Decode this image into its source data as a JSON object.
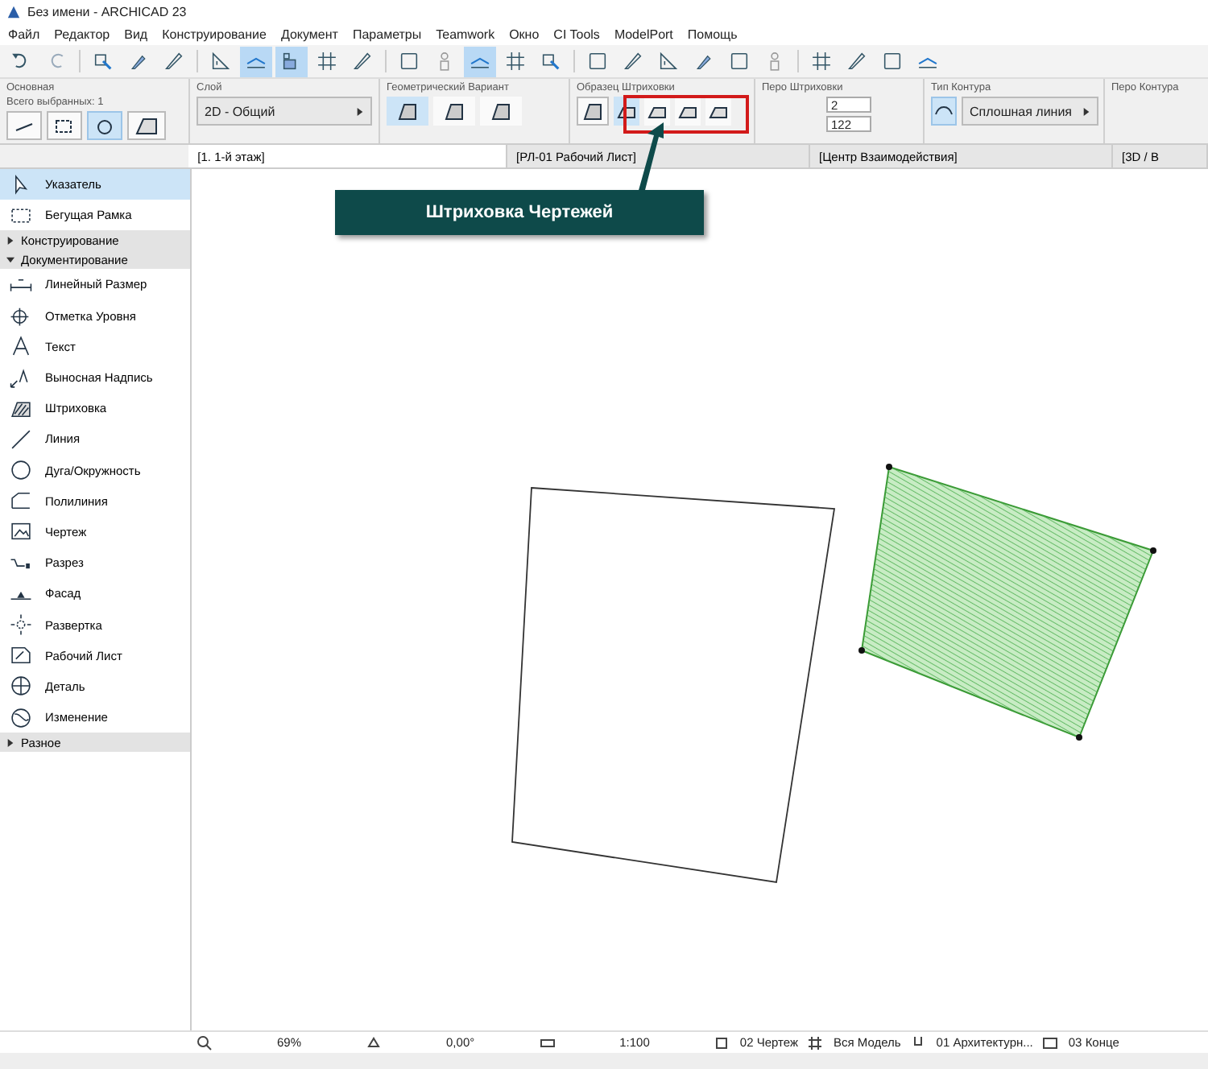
{
  "window": {
    "title": "Без имени - ARCHICAD 23"
  },
  "menu": [
    "Файл",
    "Редактор",
    "Вид",
    "Конструирование",
    "Документ",
    "Параметры",
    "Teamwork",
    "Окно",
    "CI Tools",
    "ModelPort",
    "Помощь"
  ],
  "toolbar": [
    {
      "kind": "undo",
      "selected": false
    },
    {
      "kind": "redo",
      "selected": false
    },
    {
      "kind": "sep"
    },
    {
      "kind": "pick",
      "selected": false
    },
    {
      "kind": "dropper",
      "selected": false
    },
    {
      "kind": "pen",
      "selected": false
    },
    {
      "kind": "sep"
    },
    {
      "kind": "angle",
      "selected": false
    },
    {
      "kind": "snap",
      "selected": true
    },
    {
      "kind": "layer",
      "selected": true
    },
    {
      "kind": "grid",
      "selected": false
    },
    {
      "kind": "pen",
      "selected": false
    },
    {
      "kind": "sep"
    },
    {
      "kind": "frame",
      "selected": false
    },
    {
      "kind": "person",
      "selected": false
    },
    {
      "kind": "snap",
      "selected": true
    },
    {
      "kind": "grid",
      "selected": false
    },
    {
      "kind": "pick",
      "selected": false
    },
    {
      "kind": "sep"
    },
    {
      "kind": "frame",
      "selected": false
    },
    {
      "kind": "pen",
      "selected": false
    },
    {
      "kind": "angle",
      "selected": false
    },
    {
      "kind": "dropper",
      "selected": false
    },
    {
      "kind": "frame",
      "selected": false
    },
    {
      "kind": "person",
      "selected": false
    },
    {
      "kind": "sep"
    },
    {
      "kind": "grid",
      "selected": false
    },
    {
      "kind": "pen",
      "selected": false
    },
    {
      "kind": "frame",
      "selected": false
    },
    {
      "kind": "snap",
      "selected": false
    }
  ],
  "info_box": {
    "basic": {
      "label": "Основная",
      "selection": "Всего выбранных: 1"
    },
    "layer": {
      "label": "Слой",
      "value": "2D - Общий"
    },
    "geometry": {
      "label": "Геометрический Вариант",
      "options": [
        {
          "selected": true
        },
        {
          "selected": false
        },
        {
          "selected": false
        }
      ]
    },
    "fill_pattern": {
      "label": "Образец Штриховки",
      "options": [
        {
          "selected": true
        },
        {
          "selected": false
        },
        {
          "selected": false
        },
        {
          "selected": false
        }
      ]
    },
    "fill_pen": {
      "label": "Перо Штриховки",
      "values": [
        "2",
        "122"
      ]
    },
    "contour": {
      "label": "Тип Контура",
      "value": "Сплошная линия"
    },
    "contour_pen": {
      "label": "Перо Контура"
    }
  },
  "tabs": [
    {
      "label": "[1. 1-й этаж]",
      "selected": true
    },
    {
      "label": "[РЛ-01 Рабочий Лист]",
      "selected": false
    },
    {
      "label": "[Центр Взаимодействия]",
      "selected": false
    },
    {
      "label": "[3D / В",
      "selected": false
    }
  ],
  "palette": [
    {
      "kind": "tool",
      "label": "Указатель",
      "selected": true
    },
    {
      "kind": "tool",
      "label": "Бегущая Рамка",
      "selected": false
    },
    {
      "kind": "section",
      "label": "Конструирование",
      "expanded": false
    },
    {
      "kind": "section",
      "label": "Документирование",
      "expanded": true
    },
    {
      "kind": "tool",
      "label": "Линейный Размер",
      "selected": false
    },
    {
      "kind": "tool",
      "label": "Отметка Уровня",
      "selected": false
    },
    {
      "kind": "tool",
      "label": "Текст",
      "selected": false
    },
    {
      "kind": "tool",
      "label": "Выносная Надпись",
      "selected": false
    },
    {
      "kind": "tool",
      "label": "Штриховка",
      "selected": false
    },
    {
      "kind": "tool",
      "label": "Линия",
      "selected": false
    },
    {
      "kind": "tool",
      "label": "Дуга/Окружность",
      "selected": false
    },
    {
      "kind": "tool",
      "label": "Полилиния",
      "selected": false
    },
    {
      "kind": "tool",
      "label": "Чертеж",
      "selected": false
    },
    {
      "kind": "tool",
      "label": "Разрез",
      "selected": false
    },
    {
      "kind": "tool",
      "label": "Фасад",
      "selected": false
    },
    {
      "kind": "tool",
      "label": "Развертка",
      "selected": false
    },
    {
      "kind": "tool",
      "label": "Рабочий Лист",
      "selected": false
    },
    {
      "kind": "tool",
      "label": "Деталь",
      "selected": false
    },
    {
      "kind": "tool",
      "label": "Изменение",
      "selected": false
    },
    {
      "kind": "section",
      "label": "Разное",
      "expanded": false
    }
  ],
  "callout": {
    "text": "Штриховка Чертежей"
  },
  "status_bar": {
    "zoom": "69%",
    "angle": "0,00°",
    "scale": "1:100",
    "pen_set": "02 Чертеж",
    "model_view": "Вся Модель",
    "layer_combo": "01 Архитектурн...",
    "dimension": "03 Конце"
  }
}
